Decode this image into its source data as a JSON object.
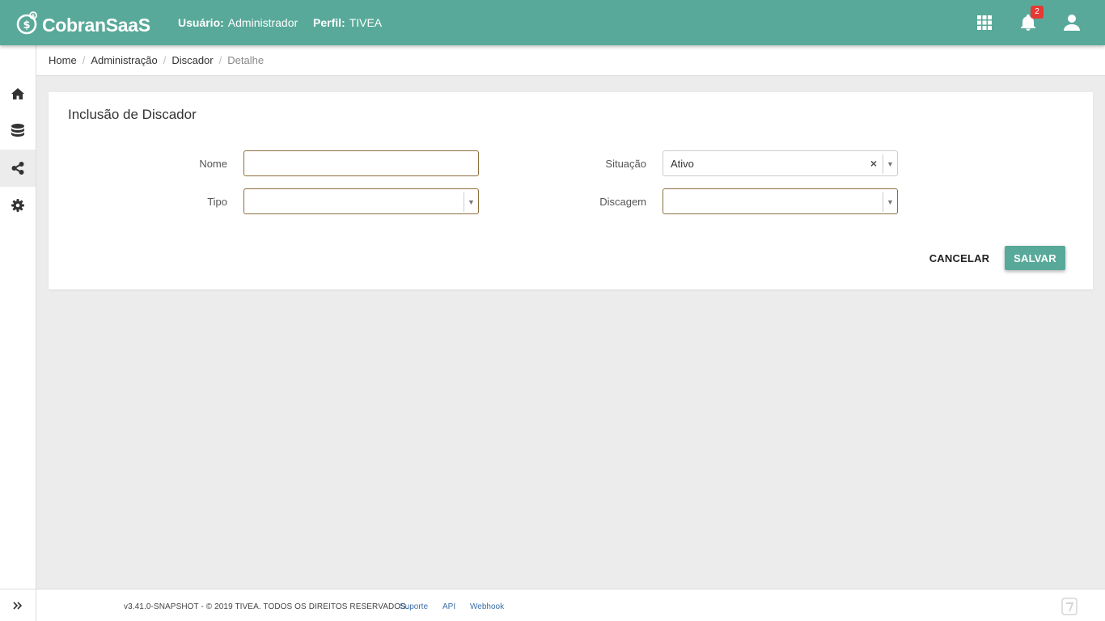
{
  "app": {
    "logo_text": "CobranSaaS",
    "user_label": "Usuário:",
    "user_value": "Administrador",
    "profile_label": "Perfil:",
    "profile_value": "TIVEA",
    "notification_count": "2",
    "accent_color": "#58a999"
  },
  "sidebar": {
    "items": [
      {
        "name": "home",
        "icon": "home-icon"
      },
      {
        "name": "database",
        "icon": "database-icon"
      },
      {
        "name": "share",
        "icon": "share-icon",
        "active": true
      },
      {
        "name": "settings",
        "icon": "gear-icon"
      }
    ],
    "expand_icon": "double-chevron-right-icon"
  },
  "breadcrumb": {
    "items": [
      "Home",
      "Administração",
      "Discador",
      "Detalhe"
    ],
    "separator": "/"
  },
  "form": {
    "title": "Inclusão de Discador",
    "nome_label": "Nome",
    "nome_value": "",
    "tipo_label": "Tipo",
    "tipo_value": "",
    "situacao_label": "Situação",
    "situacao_value": "Ativo",
    "situacao_clear": "×",
    "discagem_label": "Discagem",
    "discagem_value": "",
    "arrow": "▼",
    "cancel_label": "CANCELAR",
    "save_label": "SALVAR"
  },
  "footer": {
    "copyright": "v3.41.0-SNAPSHOT - © 2019 TIVEA. TODOS OS DIREITOS RESERVADOS.",
    "links": [
      "Suporte",
      "API",
      "Webhook"
    ]
  }
}
